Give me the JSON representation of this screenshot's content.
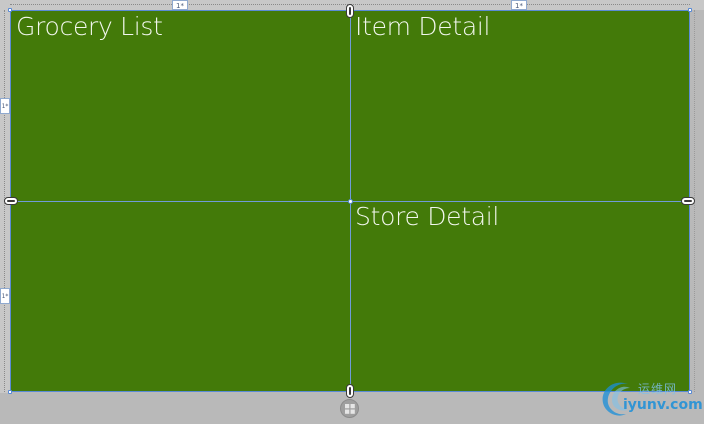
{
  "grid": {
    "cells": {
      "grocery_list": "Grocery List",
      "item_detail": "Item Detail",
      "store_detail": "Store Detail"
    },
    "column_sizes": [
      "1*",
      "1*"
    ],
    "row_sizes": [
      "1*",
      "1*"
    ]
  },
  "watermark": {
    "cn_text": "运维网",
    "site": "iyunv.com"
  },
  "icons": {
    "app_button": "windows-logo-icon",
    "grid_handle": "grid-divider-handle-icon"
  },
  "colors": {
    "grid_background": "#437a09",
    "grid_lines": "#6f9bd8",
    "text": "#f2f7ee",
    "designer_background": "#b9b9b9"
  }
}
